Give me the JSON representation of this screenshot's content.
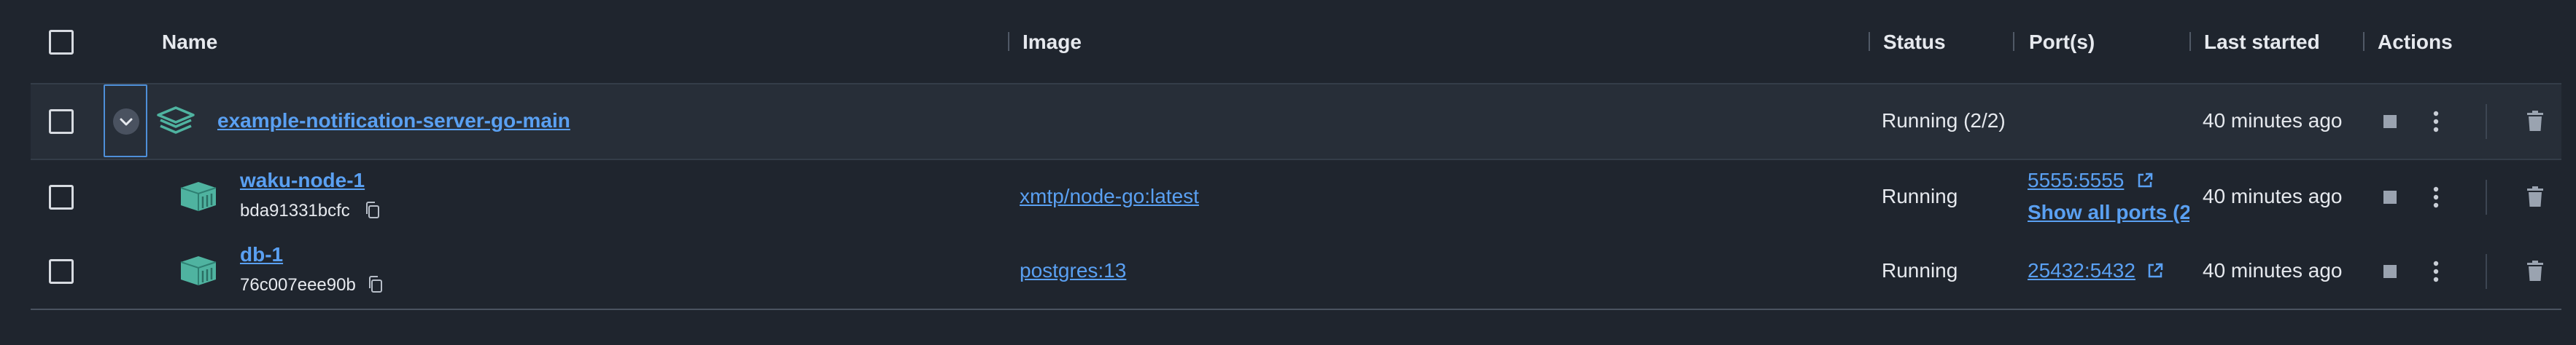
{
  "columns": {
    "name": "Name",
    "image": "Image",
    "status": "Status",
    "ports": "Port(s)",
    "last_started": "Last started",
    "actions": "Actions"
  },
  "group": {
    "name": "example-notification-server-go-main",
    "status": "Running (2/2)",
    "last_started": "40 minutes ago",
    "icon": "stack-icon"
  },
  "containers": [
    {
      "name": "waku-node-1",
      "id": "bda91331bcfc",
      "image": "xmtp/node-go:latest",
      "status": "Running",
      "port": "5555:5555",
      "more_ports": "Show all ports (2",
      "last_started": "40 minutes ago",
      "icon": "container-icon"
    },
    {
      "name": "db-1",
      "id": "76c007eee90b",
      "image": "postgres:13",
      "status": "Running",
      "port": "25432:5432",
      "last_started": "40 minutes ago",
      "icon": "container-icon"
    }
  ],
  "colors": {
    "background": "#1f252e",
    "group_row": "#272e38",
    "link": "#5aa0f2",
    "container_icon": "#4fb3a0"
  }
}
